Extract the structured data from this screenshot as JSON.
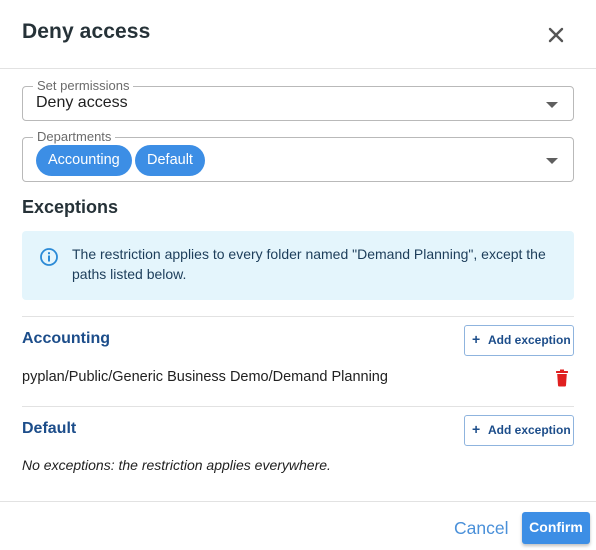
{
  "dialog": {
    "title": "Deny access"
  },
  "permissions": {
    "label": "Set permissions",
    "value": "Deny access"
  },
  "departments": {
    "label": "Departments",
    "chips": [
      "Accounting",
      "Default"
    ]
  },
  "exceptions": {
    "heading": "Exceptions",
    "info": "The restriction applies to every folder named \"Demand Planning\", except the paths listed below.",
    "groups": [
      {
        "title": "Accounting",
        "add_label": "Add exception",
        "paths": [
          "pyplan/Public/Generic Business Demo/Demand Planning"
        ]
      },
      {
        "title": "Default",
        "add_label": "Add exception",
        "empty_text": "No exceptions: the restriction applies everywhere."
      }
    ]
  },
  "footer": {
    "cancel_label": "Cancel",
    "confirm_label": "Confirm"
  },
  "icons": {
    "close": "close-icon",
    "info": "info-icon",
    "add": "plus-icon",
    "delete": "trash-icon",
    "dropdown": "caret-down-icon"
  },
  "colors": {
    "primary": "#3c8ee5",
    "info_bg": "#e4f5fc",
    "heading_blue": "#1c4d8a",
    "delete_red": "#e02020"
  }
}
